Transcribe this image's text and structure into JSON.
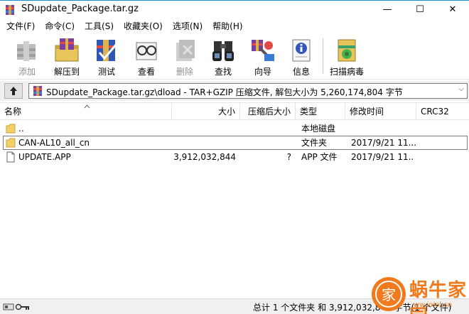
{
  "window": {
    "title": "SDupdate_Package.tar.gz",
    "minimize_glyph": "—",
    "maximize_glyph": "☐",
    "close_glyph": "✕"
  },
  "menu": [
    "文件(F)",
    "命令(C)",
    "工具(S)",
    "收藏夹(O)",
    "选项(N)",
    "帮助(H)"
  ],
  "toolbar": {
    "buttons": [
      {
        "label": "添加",
        "icon": "add-icon",
        "enabled": false
      },
      {
        "label": "解压到",
        "icon": "extract-to-icon",
        "enabled": true
      },
      {
        "label": "测试",
        "icon": "test-icon",
        "enabled": true
      },
      {
        "label": "查看",
        "icon": "view-icon",
        "enabled": true
      },
      {
        "label": "删除",
        "icon": "delete-icon",
        "enabled": false
      },
      {
        "label": "查找",
        "icon": "find-icon",
        "enabled": true
      },
      {
        "label": "向导",
        "icon": "wizard-icon",
        "enabled": true
      },
      {
        "label": "信息",
        "icon": "info-icon",
        "enabled": true
      },
      {
        "label": "扫描病毒",
        "icon": "virus-scan-icon",
        "enabled": true
      }
    ]
  },
  "address": {
    "path": "SDupdate_Package.tar.gz\\dload - TAR+GZIP 压缩文件, 解包大小为 5,260,174,804 字节",
    "dropdown_glyph": "⌵"
  },
  "columns": {
    "name": "名称",
    "size": "大小",
    "packed": "压缩后大小",
    "type": "类型",
    "modified": "修改时间",
    "crc": "CRC32"
  },
  "rows": [
    {
      "name": "..",
      "size": "",
      "packed": "",
      "type": "本地磁盘",
      "modified": "",
      "crc": "",
      "icon": "folder-up-icon"
    },
    {
      "name": "CAN-AL10_all_cn",
      "size": "",
      "packed": "",
      "type": "文件夹",
      "modified": "2017/9/21 11...",
      "crc": "",
      "icon": "folder-icon"
    },
    {
      "name": "UPDATE.APP",
      "size": "3,912,032,844",
      "packed": "?",
      "type": "APP 文件",
      "modified": "2017/9/21 11...",
      "crc": "",
      "icon": "file-icon"
    }
  ],
  "status": {
    "text": "总计 1 个文件夹 和 3,912,032,844 字节(1 个文件)"
  },
  "watermark": {
    "text": "蜗牛家园",
    "url": "ww.ioiol.cn",
    "badge": "家"
  },
  "colors": {
    "accent": "#1f8dd6",
    "watermark": "#f07a1c",
    "folder": "#f4d06a"
  }
}
